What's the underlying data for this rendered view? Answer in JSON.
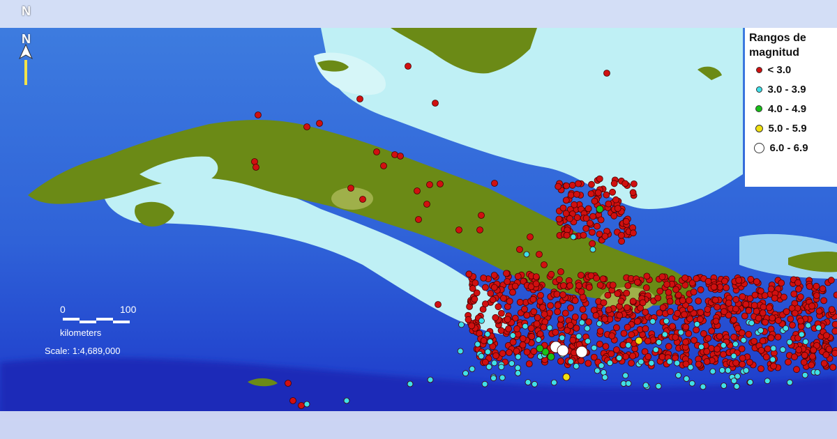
{
  "map": {
    "north_label_top": "N",
    "north_label_arrow": "N",
    "colors": {
      "deep_ocean": "#1a33c8",
      "mid_ocean": "#3f7fe0",
      "shelf": "#bff0f5",
      "land": "#6b8a16",
      "land_high": "#9fb04a",
      "fade_band": "#dfe6f7"
    }
  },
  "legend": {
    "title": "Rangos de magnitud",
    "items": [
      {
        "label": "< 3.0",
        "color": "#d01010",
        "size": 9
      },
      {
        "label": "3.0 - 3.9",
        "color": "#3fe0e8",
        "size": 9
      },
      {
        "label": "4.0 - 4.9",
        "color": "#18c018",
        "size": 10
      },
      {
        "label": "5.0 - 5.9",
        "color": "#f0e010",
        "size": 11
      },
      {
        "label": "6.0 - 6.9",
        "color": "#ffffff",
        "size": 15
      }
    ]
  },
  "scale": {
    "tick_start": "0",
    "tick_end": "100",
    "units": "kilometers",
    "ratio": "Scale: 1:4,689,000"
  }
}
